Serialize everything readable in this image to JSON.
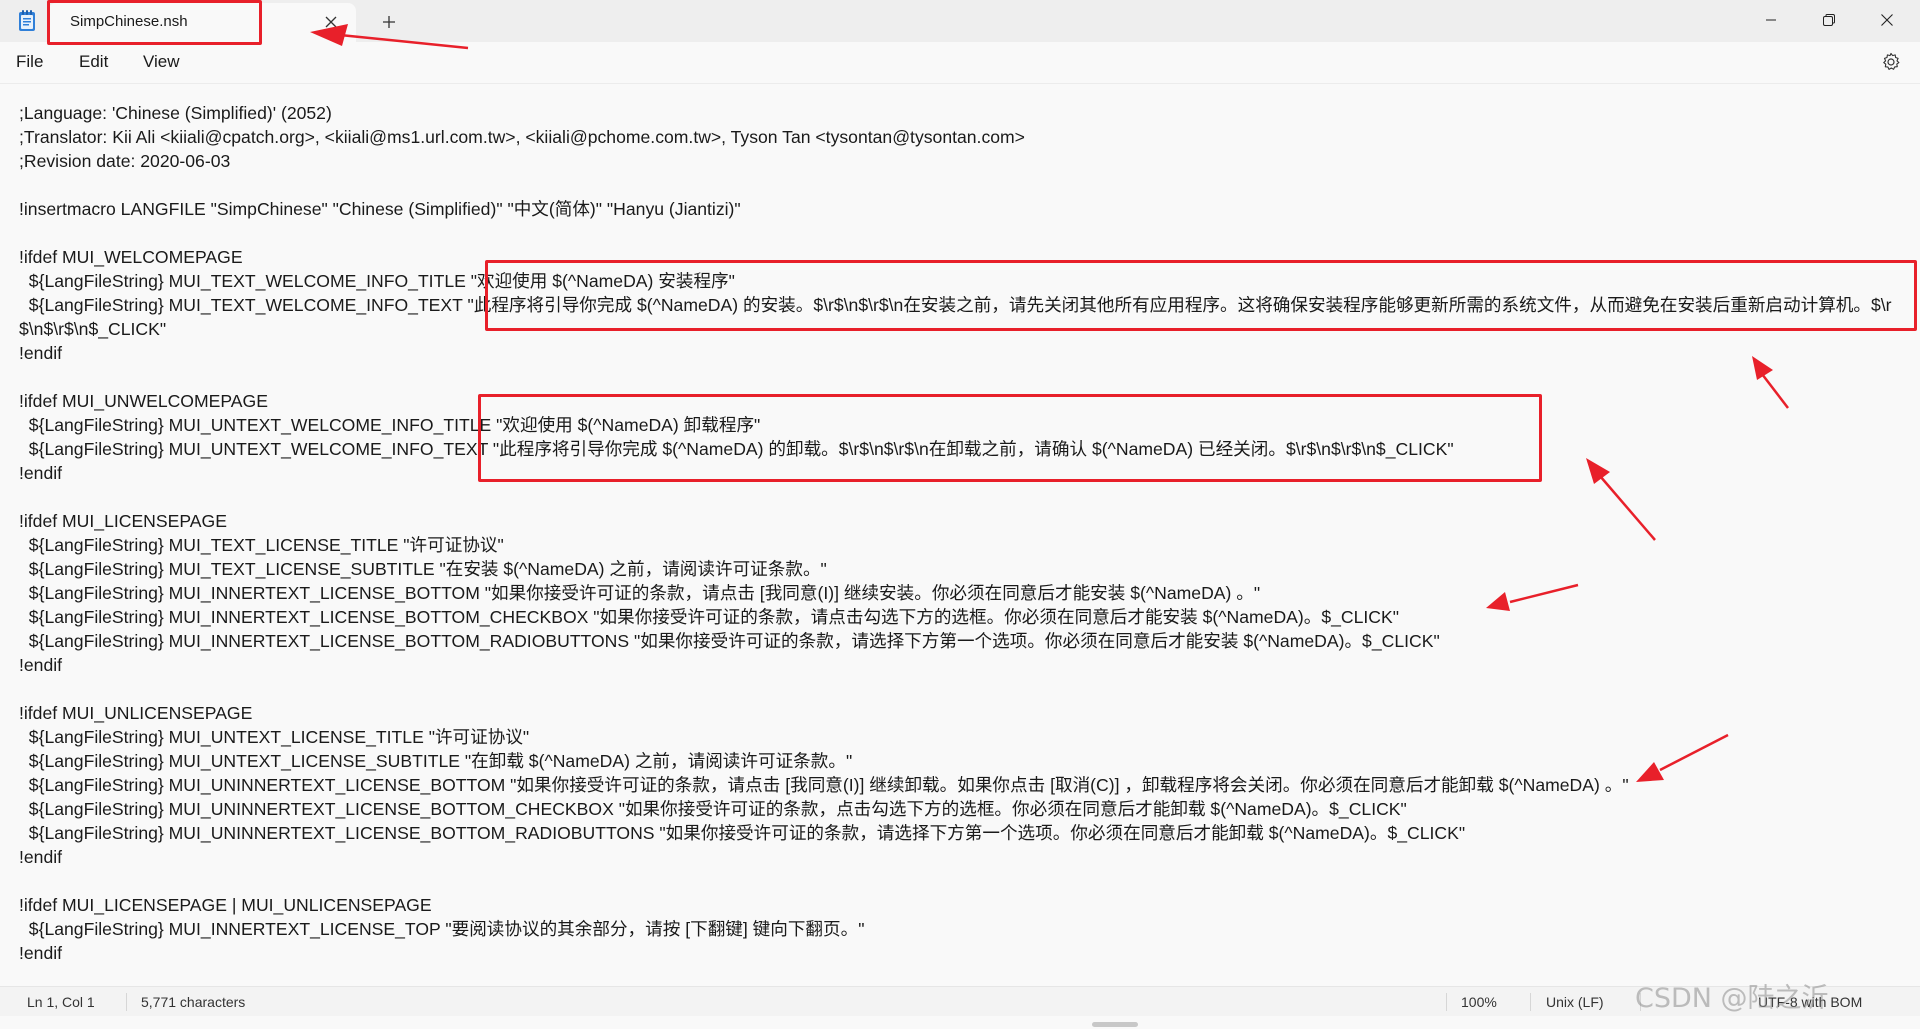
{
  "window": {
    "tab_title": "SimpChinese.nsh",
    "new_tab_symbol": "+",
    "close_tab_symbol": "×"
  },
  "menu": {
    "file": "File",
    "edit": "Edit",
    "view": "View"
  },
  "editor": {
    "lines": [
      ";Language: 'Chinese (Simplified)' (2052)",
      ";Translator: Kii Ali <kiiali@cpatch.org>, <kiiali@ms1.url.com.tw>, <kiiali@pchome.com.tw>, Tyson Tan <tysontan@tysontan.com>",
      ";Revision date: 2020-06-03",
      "",
      "!insertmacro LANGFILE \"SimpChinese\" \"Chinese (Simplified)\" \"中文(简体)\" \"Hanyu (Jiantizi)\"",
      "",
      "!ifdef MUI_WELCOMEPAGE",
      "  ${LangFileString} MUI_TEXT_WELCOME_INFO_TITLE \"欢迎使用 $(^NameDA) 安装程序\"",
      "  ${LangFileString} MUI_TEXT_WELCOME_INFO_TEXT \"此程序将引导你完成 $(^NameDA) 的安装。$\\r$\\n$\\r$\\n在安装之前，请先关闭其他所有应用程序。这将确保安装程序能够更新所需的系统文件，从而避免在安装后重新启动计算机。$\\r$\\n$\\r$\\n$_CLICK\"",
      "!endif",
      "",
      "!ifdef MUI_UNWELCOMEPAGE",
      "  ${LangFileString} MUI_UNTEXT_WELCOME_INFO_TITLE \"欢迎使用 $(^NameDA) 卸载程序\"",
      "  ${LangFileString} MUI_UNTEXT_WELCOME_INFO_TEXT \"此程序将引导你完成 $(^NameDA) 的卸载。$\\r$\\n$\\r$\\n在卸载之前，请确认 $(^NameDA) 已经关闭。$\\r$\\n$\\r$\\n$_CLICK\"",
      "!endif",
      "",
      "!ifdef MUI_LICENSEPAGE",
      "  ${LangFileString} MUI_TEXT_LICENSE_TITLE \"许可证协议\"",
      "  ${LangFileString} MUI_TEXT_LICENSE_SUBTITLE \"在安装 $(^NameDA) 之前，请阅读许可证条款。\"",
      "  ${LangFileString} MUI_INNERTEXT_LICENSE_BOTTOM \"如果你接受许可证的条款，请点击 [我同意(I)] 继续安装。你必须在同意后才能安装 $(^NameDA) 。\"",
      "  ${LangFileString} MUI_INNERTEXT_LICENSE_BOTTOM_CHECKBOX \"如果你接受许可证的条款，请点击勾选下方的选框。你必须在同意后才能安装 $(^NameDA)。$_CLICK\"",
      "  ${LangFileString} MUI_INNERTEXT_LICENSE_BOTTOM_RADIOBUTTONS \"如果你接受许可证的条款，请选择下方第一个选项。你必须在同意后才能安装 $(^NameDA)。$_CLICK\"",
      "!endif",
      "",
      "!ifdef MUI_UNLICENSEPAGE",
      "  ${LangFileString} MUI_UNTEXT_LICENSE_TITLE \"许可证协议\"",
      "  ${LangFileString} MUI_UNTEXT_LICENSE_SUBTITLE \"在卸载 $(^NameDA) 之前，请阅读许可证条款。\"",
      "  ${LangFileString} MUI_UNINNERTEXT_LICENSE_BOTTOM \"如果你接受许可证的条款，请点击 [我同意(I)] 继续卸载。如果你点击 [取消(C)] ，卸载程序将会关闭。你必须在同意后才能卸载 $(^NameDA) 。\"",
      "  ${LangFileString} MUI_UNINNERTEXT_LICENSE_BOTTOM_CHECKBOX \"如果你接受许可证的条款，点击勾选下方的选框。你必须在同意后才能卸载 $(^NameDA)。$_CLICK\"",
      "  ${LangFileString} MUI_UNINNERTEXT_LICENSE_BOTTOM_RADIOBUTTONS \"如果你接受许可证的条款，请选择下方第一个选项。你必须在同意后才能卸载 $(^NameDA)。$_CLICK\"",
      "!endif",
      "",
      "!ifdef MUI_LICENSEPAGE | MUI_UNLICENSEPAGE",
      "  ${LangFileString} MUI_INNERTEXT_LICENSE_TOP \"要阅读协议的其余部分，请按 [下翻键] 键向下翻页。\"",
      "!endif"
    ]
  },
  "status": {
    "position": "Ln 1, Col 1",
    "characters": "5,771 characters",
    "zoom": "100%",
    "line_ending": "Unix (LF)",
    "encoding": "UTF-8 with BOM"
  },
  "watermark": "CSDN @陆之沂",
  "colors": {
    "annotation": "#e8202a"
  }
}
